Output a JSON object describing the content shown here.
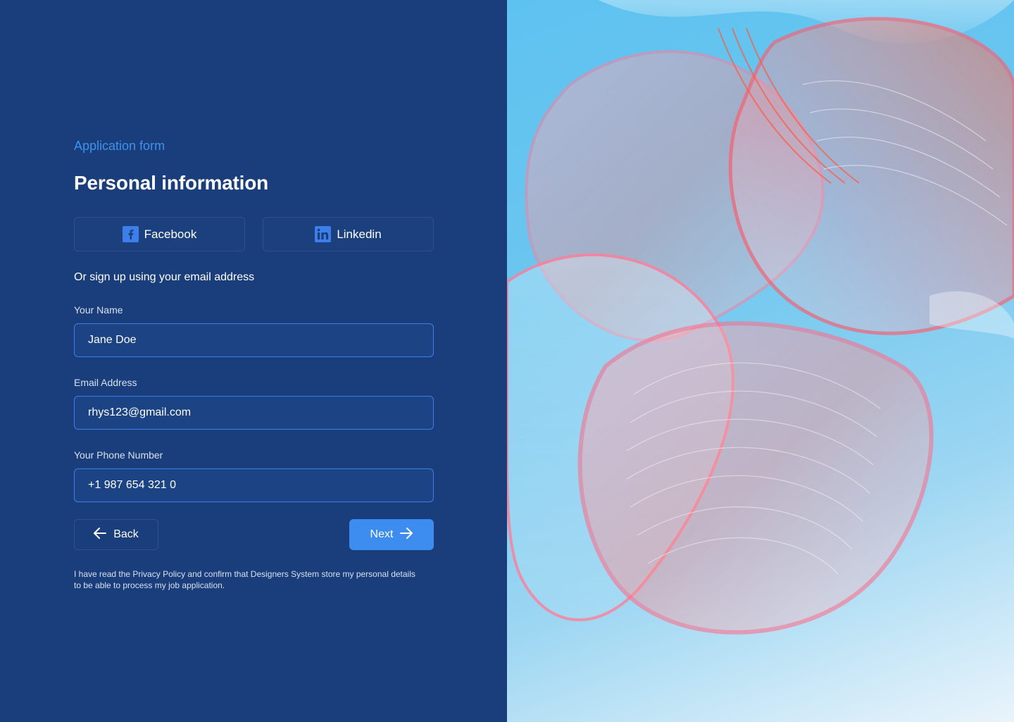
{
  "form": {
    "eyebrow": "Application form",
    "title": "Personal information",
    "social": {
      "facebook_label": "Facebook",
      "linkedin_label": "Linkedin"
    },
    "divider_text": "Or sign up using your email address",
    "fields": {
      "name": {
        "label": "Your Name",
        "value": "Jane Doe"
      },
      "email": {
        "label": "Email Address",
        "value": "rhys123@gmail.com"
      },
      "phone": {
        "label": "Your Phone Number",
        "value": "+1 987 654 321 0"
      }
    },
    "actions": {
      "back_label": "Back",
      "next_label": "Next"
    },
    "consent_text": "I have read the Privacy Policy and confirm that Designers System store my personal details to be able to process my job application."
  },
  "icons": {
    "facebook": "facebook-icon",
    "linkedin": "linkedin-icon",
    "back": "arrow-left-icon",
    "next": "arrow-right-icon"
  },
  "colors": {
    "panel_background": "#1a3e7c",
    "accent": "#3d8cf0",
    "eyebrow": "#3d92ea",
    "input_border": "#3d7fea"
  }
}
